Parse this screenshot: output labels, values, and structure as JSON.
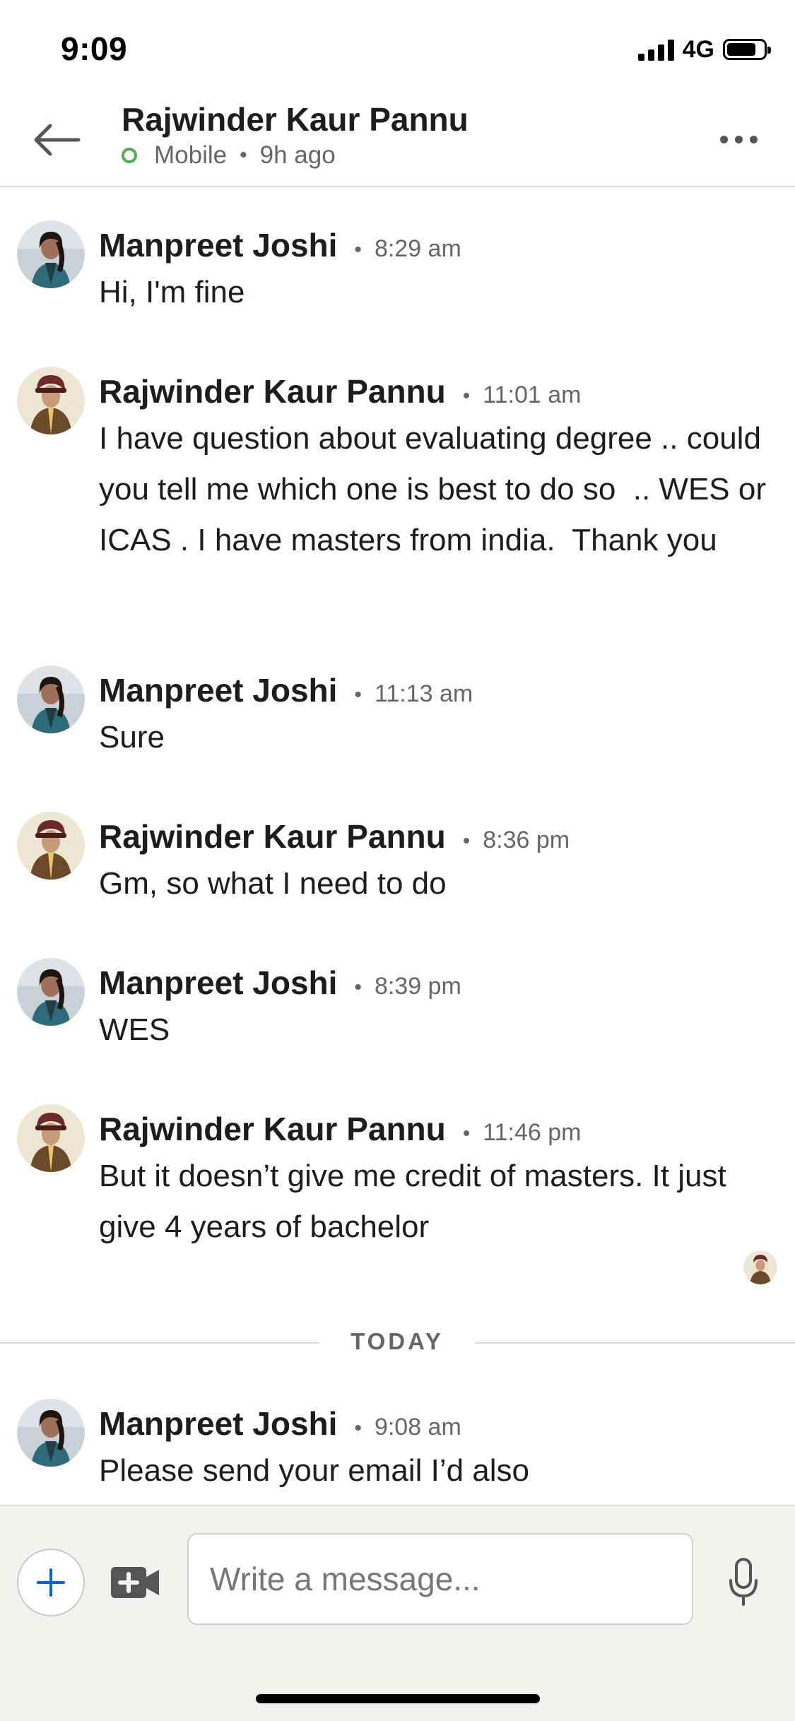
{
  "status_bar": {
    "time": "9:09",
    "network": "4G",
    "battery_level": 0.8
  },
  "header": {
    "contact_name": "Rajwinder Kaur Pannu",
    "presence": "Mobile",
    "last_active": "9h ago"
  },
  "messages": [
    {
      "sender": "Manpreet Joshi",
      "time": "8:29 am",
      "text": "Hi, I'm fine",
      "avatar": "manpreet-avatar"
    },
    {
      "sender": "Rajwinder Kaur Pannu",
      "time": "11:01 am",
      "text": "I have question about evaluating degree .. could you tell me which one is best to do so  .. WES or ICAS . I have masters from india.  Thank you",
      "avatar": "rajwinder-avatar"
    },
    {
      "sender": "Manpreet Joshi",
      "time": "11:13 am",
      "text": "Sure",
      "avatar": "manpreet-avatar"
    },
    {
      "sender": "Rajwinder Kaur Pannu",
      "time": "8:36 pm",
      "text": "Gm, so what I need to do",
      "avatar": "rajwinder-avatar"
    },
    {
      "sender": "Manpreet Joshi",
      "time": "8:39 pm",
      "text": "WES",
      "avatar": "manpreet-avatar"
    },
    {
      "sender": "Rajwinder Kaur Pannu",
      "time": "11:46 pm",
      "text": "But it doesn’t give me credit of masters. It just give 4 years of bachelor",
      "avatar": "rajwinder-avatar"
    },
    {
      "sender": "Manpreet Joshi",
      "time": "9:08 am",
      "text": "Please send your email I’d also",
      "avatar": "manpreet-avatar"
    }
  ],
  "day_divider": "TODAY",
  "composer": {
    "placeholder": "Write a message...",
    "value": ""
  },
  "icons": {
    "back": "arrow-left-icon",
    "more": "more-horizontal-icon",
    "attach": "plus-icon",
    "video": "video-camera-icon",
    "mic": "microphone-icon"
  },
  "colors": {
    "online": "#4caf50",
    "accent": "#0a66c2",
    "composer_bg": "#f3f2ef"
  }
}
